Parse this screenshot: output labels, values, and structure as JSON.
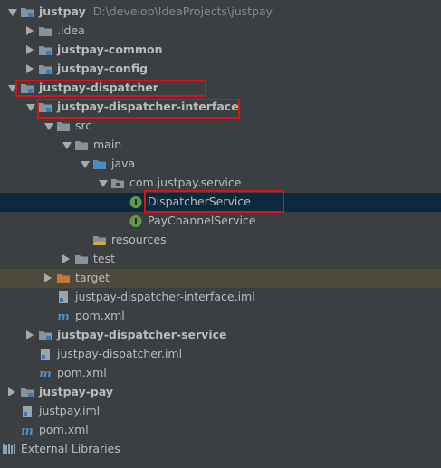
{
  "tree": {
    "rows": [
      {
        "depth": 0,
        "arrow": "down",
        "icon": "module-folder-icon",
        "label": "justpay",
        "path": "D:\\develop\\IdeaProjects\\justpay",
        "bold": true
      },
      {
        "depth": 1,
        "arrow": "right",
        "icon": "folder-icon",
        "label": ".idea",
        "bold": false
      },
      {
        "depth": 1,
        "arrow": "right",
        "icon": "module-folder-icon",
        "label": "justpay-common",
        "bold": true
      },
      {
        "depth": 1,
        "arrow": "right",
        "icon": "module-folder-icon",
        "label": "justpay-config",
        "bold": true
      },
      {
        "depth": 0,
        "arrow": "down",
        "icon": "module-folder-icon",
        "label": "justpay-dispatcher",
        "bold": true
      },
      {
        "depth": 1,
        "arrow": "down",
        "icon": "module-folder-icon",
        "label": "justpay-dispatcher-interface",
        "bold": true
      },
      {
        "depth": 2,
        "arrow": "down",
        "icon": "folder-icon",
        "label": "src",
        "bold": false
      },
      {
        "depth": 3,
        "arrow": "down",
        "icon": "folder-icon",
        "label": "main",
        "bold": false
      },
      {
        "depth": 4,
        "arrow": "down",
        "icon": "source-folder-icon",
        "label": "java",
        "bold": false
      },
      {
        "depth": 5,
        "arrow": "down",
        "icon": "package-icon",
        "label": "com.justpay.service",
        "bold": false
      },
      {
        "depth": 6,
        "arrow": "none",
        "icon": "interface-icon",
        "label": "DispatcherService",
        "bold": false,
        "selected": true
      },
      {
        "depth": 6,
        "arrow": "none",
        "icon": "interface-icon",
        "label": "PayChannelService",
        "bold": false
      },
      {
        "depth": 4,
        "arrow": "none",
        "icon": "resources-folder-icon",
        "label": "resources",
        "bold": false
      },
      {
        "depth": 3,
        "arrow": "right",
        "icon": "folder-icon",
        "label": "test",
        "bold": false
      },
      {
        "depth": 2,
        "arrow": "right",
        "icon": "excluded-folder-icon",
        "label": "target",
        "bold": false,
        "excluded": true
      },
      {
        "depth": 2,
        "arrow": "none",
        "icon": "iml-file-icon",
        "label": "justpay-dispatcher-interface.iml",
        "bold": false
      },
      {
        "depth": 2,
        "arrow": "none",
        "icon": "maven-icon",
        "label": "pom.xml",
        "bold": false
      },
      {
        "depth": 1,
        "arrow": "right",
        "icon": "module-folder-icon",
        "label": "justpay-dispatcher-service",
        "bold": true
      },
      {
        "depth": 1,
        "arrow": "none",
        "icon": "iml-file-icon",
        "label": "justpay-dispatcher.iml",
        "bold": false
      },
      {
        "depth": 1,
        "arrow": "none",
        "icon": "maven-icon",
        "label": "pom.xml",
        "bold": false
      },
      {
        "depth": 0,
        "arrow": "right",
        "icon": "module-folder-icon",
        "label": "justpay-pay",
        "bold": true
      },
      {
        "depth": 0,
        "arrow": "none",
        "icon": "iml-file-icon",
        "label": "justpay.iml",
        "bold": false
      },
      {
        "depth": 0,
        "arrow": "none",
        "icon": "maven-icon",
        "label": "pom.xml",
        "bold": false
      },
      {
        "depth": -1,
        "arrow": "right",
        "icon": "libraries-icon",
        "label": "External Libraries",
        "bold": false
      }
    ]
  },
  "colors": {
    "background": "#3c3f41",
    "text": "#bbbbbb",
    "selection": "#0d293e",
    "excluded_row": "#4c4a3d",
    "highlight_box": "#e0101a",
    "folder": "#87939a",
    "source_folder": "#4a8dc0",
    "excluded_folder": "#c8733a",
    "interface_icon": "#5f9a4c",
    "maven_icon": "#4a8dc0"
  }
}
